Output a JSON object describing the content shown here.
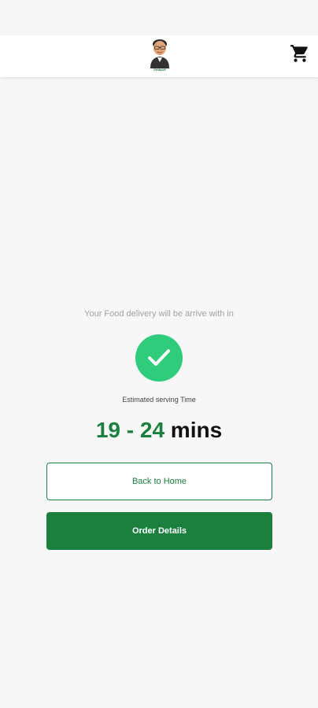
{
  "header": {
    "logo_caption": "SHIMAR",
    "cart_icon": "cart-icon"
  },
  "main": {
    "subtitle": "Your Food delivery will be arrive with in",
    "success_icon": "check-icon",
    "estimate_label": "Estimated serving Time",
    "time_range": "19 - 24",
    "time_unit": "mins"
  },
  "actions": {
    "back_label": "Back to Home",
    "details_label": "Order Details"
  },
  "colors": {
    "brand_green": "#1b7f3e",
    "check_green": "#2ecc7b",
    "background": "#f7f7f7"
  }
}
